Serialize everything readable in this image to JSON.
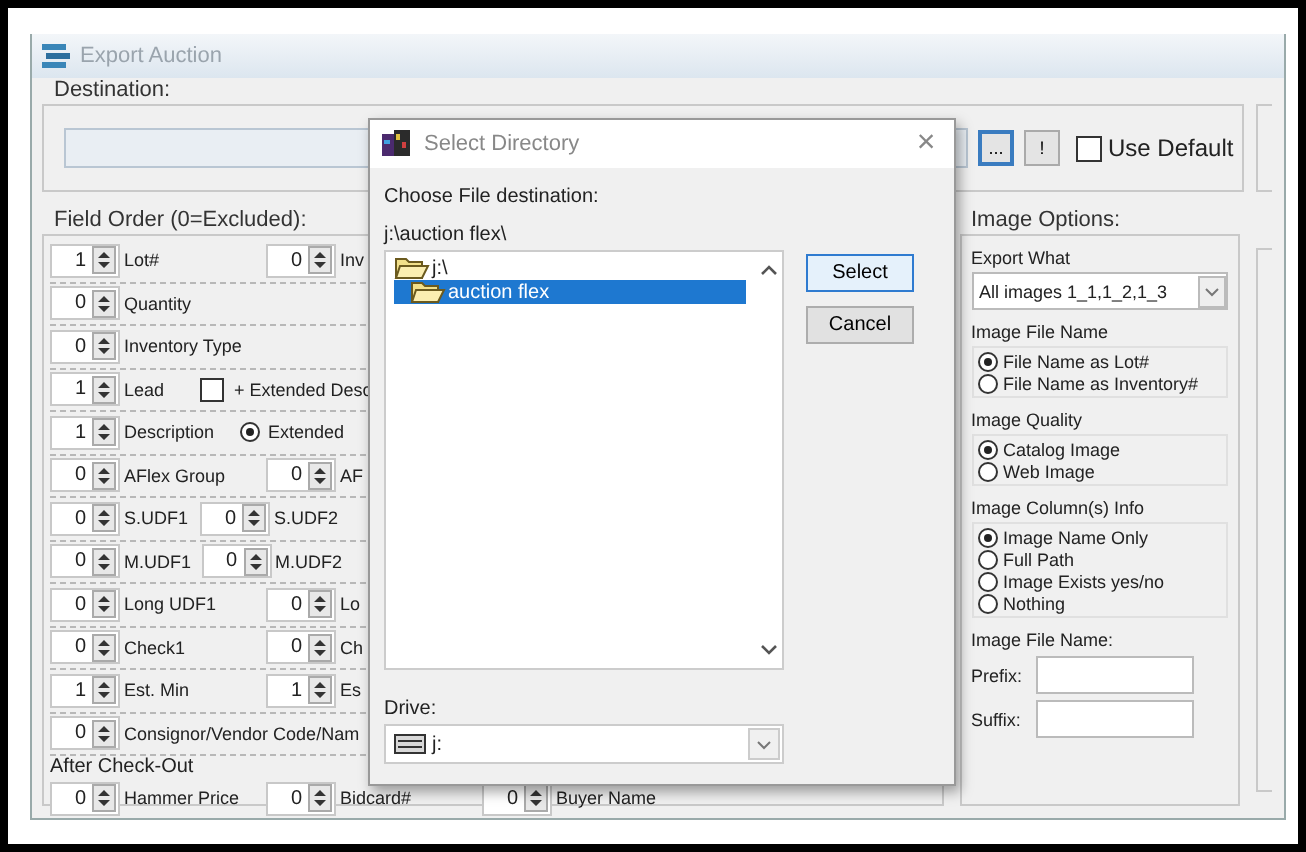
{
  "window": {
    "title": "Export Auction"
  },
  "destination": {
    "label": "Destination:",
    "browse_button": "...",
    "run_button": "!",
    "use_default": {
      "label": "Use Default",
      "checked": false
    }
  },
  "field_order": {
    "title": "Field Order (0=Excluded):",
    "rows": [
      {
        "kind": "fields",
        "compact": false,
        "items": [
          {
            "kind": "spinner",
            "value": "1",
            "label": "Lot#"
          },
          {
            "kind": "spinner",
            "value": "0",
            "label": "Inv"
          }
        ]
      },
      {
        "kind": "fields",
        "items": [
          {
            "kind": "spinner",
            "value": "0",
            "label": "Quantity"
          }
        ]
      },
      {
        "kind": "fields",
        "items": [
          {
            "kind": "spinner",
            "value": "0",
            "label": "Inventory Type"
          }
        ]
      },
      {
        "kind": "fields",
        "compact": true,
        "items": [
          {
            "kind": "spinner",
            "value": "1",
            "label": "Lead"
          },
          {
            "kind": "checkbox",
            "label": "+ Extended Desc",
            "checked": false
          }
        ]
      },
      {
        "kind": "fields",
        "compact": true,
        "items": [
          {
            "kind": "spinner",
            "value": "1",
            "label": "Description"
          },
          {
            "kind": "radio",
            "label": "Extended",
            "selected": true
          }
        ]
      },
      {
        "kind": "fields",
        "compact": false,
        "items": [
          {
            "kind": "spinner",
            "value": "0",
            "label": "AFlex Group"
          },
          {
            "kind": "spinner",
            "value": "0",
            "label": "AF"
          }
        ]
      },
      {
        "kind": "fields",
        "compact": true,
        "items": [
          {
            "kind": "spinner",
            "value": "0",
            "label": "S.UDF1"
          },
          {
            "kind": "spinner",
            "value": "0",
            "label": "S.UDF2"
          }
        ]
      },
      {
        "kind": "fields",
        "compact": true,
        "items": [
          {
            "kind": "spinner",
            "value": "0",
            "label": "M.UDF1"
          },
          {
            "kind": "spinner",
            "value": "0",
            "label": "M.UDF2"
          }
        ]
      },
      {
        "kind": "fields",
        "compact": false,
        "items": [
          {
            "kind": "spinner",
            "value": "0",
            "label": "Long UDF1"
          },
          {
            "kind": "spinner",
            "value": "0",
            "label": "Lo"
          }
        ]
      },
      {
        "kind": "fields",
        "compact": false,
        "items": [
          {
            "kind": "spinner",
            "value": "0",
            "label": "Check1"
          },
          {
            "kind": "spinner",
            "value": "0",
            "label": "Ch"
          }
        ]
      },
      {
        "kind": "fields",
        "compact": false,
        "items": [
          {
            "kind": "spinner",
            "value": "1",
            "label": "Est. Min"
          },
          {
            "kind": "spinner",
            "value": "1",
            "label": "Es"
          }
        ]
      },
      {
        "kind": "fields",
        "items": [
          {
            "kind": "spinner",
            "value": "0",
            "label": "Consignor/Vendor Code/Nam"
          }
        ]
      },
      {
        "kind": "heading",
        "text": "After Check-Out"
      },
      {
        "kind": "fields",
        "compact": false,
        "items": [
          {
            "kind": "spinner",
            "value": "0",
            "label": "Hammer Price"
          },
          {
            "kind": "spinner",
            "value": "0",
            "label": "Bidcard#"
          },
          {
            "kind": "spinner",
            "value": "0",
            "label": "Buyer Name"
          }
        ]
      }
    ]
  },
  "image_options": {
    "title": "Image Options:",
    "export_what": {
      "label": "Export What",
      "value": "All images 1_1,1_2,1_3"
    },
    "groups": [
      {
        "title": "Image File Name",
        "options": [
          {
            "label": "File Name as Lot#",
            "selected": true
          },
          {
            "label": "File Name as Inventory#",
            "selected": false
          }
        ]
      },
      {
        "title": "Image Quality",
        "options": [
          {
            "label": "Catalog Image",
            "selected": true
          },
          {
            "label": "Web Image",
            "selected": false
          }
        ]
      },
      {
        "title": "Image Column(s) Info",
        "options": [
          {
            "label": "Image Name Only",
            "selected": true
          },
          {
            "label": "Full Path",
            "selected": false
          },
          {
            "label": "Image Exists yes/no",
            "selected": false
          },
          {
            "label": "Nothing",
            "selected": false
          }
        ]
      }
    ],
    "file_name": {
      "title": "Image File Name:",
      "prefix_label": "Prefix:",
      "suffix_label": "Suffix:"
    }
  },
  "dialog": {
    "title": "Select Directory",
    "close": "×",
    "prompt": "Choose File destination:",
    "path": "j:\\auction flex\\",
    "tree": [
      {
        "label": "j:\\",
        "selected": false,
        "children": [
          {
            "label": "auction flex",
            "selected": true
          }
        ]
      }
    ],
    "buttons": [
      {
        "label": "Select",
        "default": true
      },
      {
        "label": "Cancel",
        "default": false
      }
    ],
    "drive_label": "Drive:",
    "drive_value": "j:"
  }
}
